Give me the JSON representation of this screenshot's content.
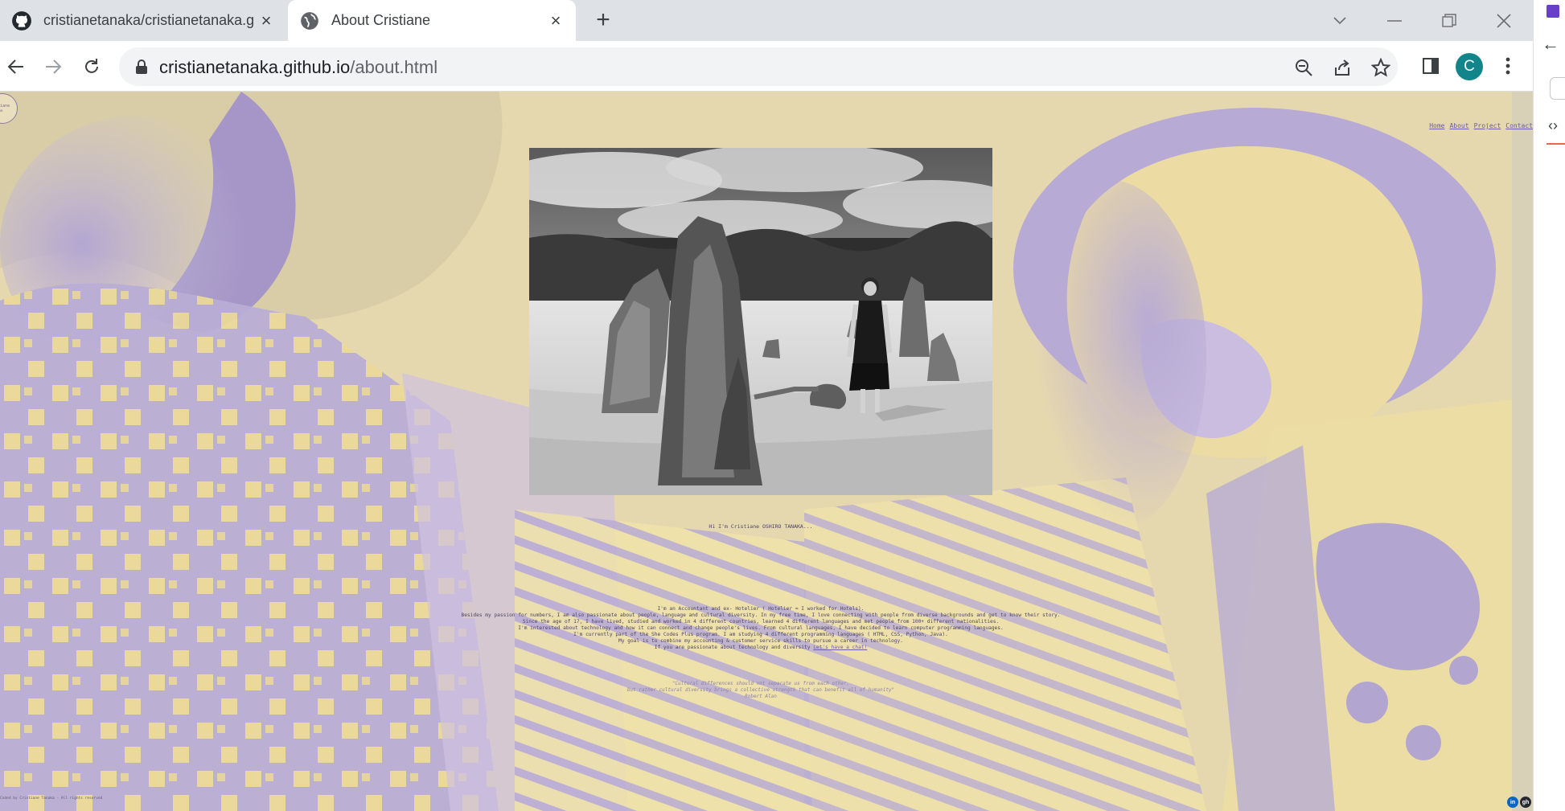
{
  "browser": {
    "tabs": [
      {
        "title": "cristianetanaka/cristianetanaka.g",
        "icon": "github-icon",
        "active": false
      },
      {
        "title": "About Cristiane",
        "icon": "globe-icon",
        "active": true
      }
    ],
    "url_host": "cristianetanaka.github.io",
    "url_path": "/about.html",
    "avatar_letter": "C"
  },
  "page": {
    "logo_text": "Cristiane Tanaka",
    "nav": [
      "Home",
      "About",
      "Project",
      "Contact"
    ],
    "greeting": "Hi I'm Cristiane OSHIRO TANAKA...",
    "bio_lines": [
      "I'm an Accountant and ex- Hotelier ( Hotelier = I worked for Hotels).",
      "Besides my passion for numbers, I am also passionate about people, language and cultural diversity. In my free time, I love connecting with people from diverse backgrounds and get to know their story.",
      "Since the age of 17, I have lived, studied and worked in 4 different countries, learned 4 different languages and met people from 100+ different nationalities.",
      "I'm interested about technology and how it can connect and change people's lives. From cultural languages, I have decided to learn computer programming languages.",
      "I'm currently part of the She Codes Plus program. I am studying 4 different programming languages ( HTML, CSS, Python, Java).",
      "My goal is to combine my accounting & customer service skills to pursue a career in technology."
    ],
    "bio_last_prefix": "If you are passionate about technology and diversity",
    "bio_link": "Let's have a chat!",
    "quote_lines": [
      "\"Cultural differences should not separate us from each other,",
      "but rather cultural diversity brings a collective strength that can benefit all of humanity\""
    ],
    "quote_author": "Robert Alan",
    "footer": "Coded by Cristiane Tanaka - All rights reserved",
    "social": [
      {
        "label": "in",
        "icon": "linkedin-icon",
        "color": "#0a66c2"
      },
      {
        "label": "gh",
        "icon": "github-icon",
        "color": "#24292f"
      }
    ]
  },
  "colors": {
    "bg_yellow": "#efe0a6",
    "bg_lilac": "#b6a8d2",
    "text": "#4a4466",
    "link": "#6b5aa8"
  }
}
